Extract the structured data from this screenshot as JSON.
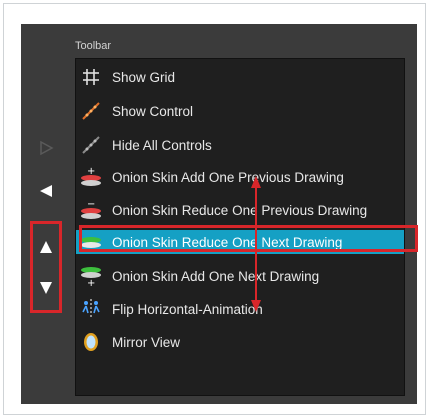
{
  "panel": {
    "title": "Toolbar"
  },
  "items": [
    {
      "label": "Show Grid",
      "icon": "grid-icon"
    },
    {
      "label": "Show Control",
      "icon": "show-control-icon"
    },
    {
      "label": "Hide All Controls",
      "icon": "hide-controls-icon"
    },
    {
      "label": "Onion Skin Add One Previous Drawing",
      "icon": "onion-add-previous-icon"
    },
    {
      "label": "Onion Skin Reduce One Previous Drawing",
      "icon": "onion-reduce-previous-icon"
    },
    {
      "label": "Onion Skin Reduce One Next Drawing",
      "icon": "onion-reduce-next-icon",
      "selected": true
    },
    {
      "label": "Onion Skin Add One Next Drawing",
      "icon": "onion-add-next-icon"
    },
    {
      "label": "Flip Horizontal-Animation",
      "icon": "flip-horizontal-icon"
    },
    {
      "label": "Mirror View",
      "icon": "mirror-view-icon"
    }
  ],
  "colors": {
    "panel_bg": "#3b3b3b",
    "list_bg": "#1f1f1f",
    "selection": "#15a0c4",
    "highlight_outline": "#d8262a"
  },
  "arrows": [
    "right-arrow-icon",
    "left-arrow-icon",
    "up-arrow-icon",
    "down-arrow-icon"
  ]
}
